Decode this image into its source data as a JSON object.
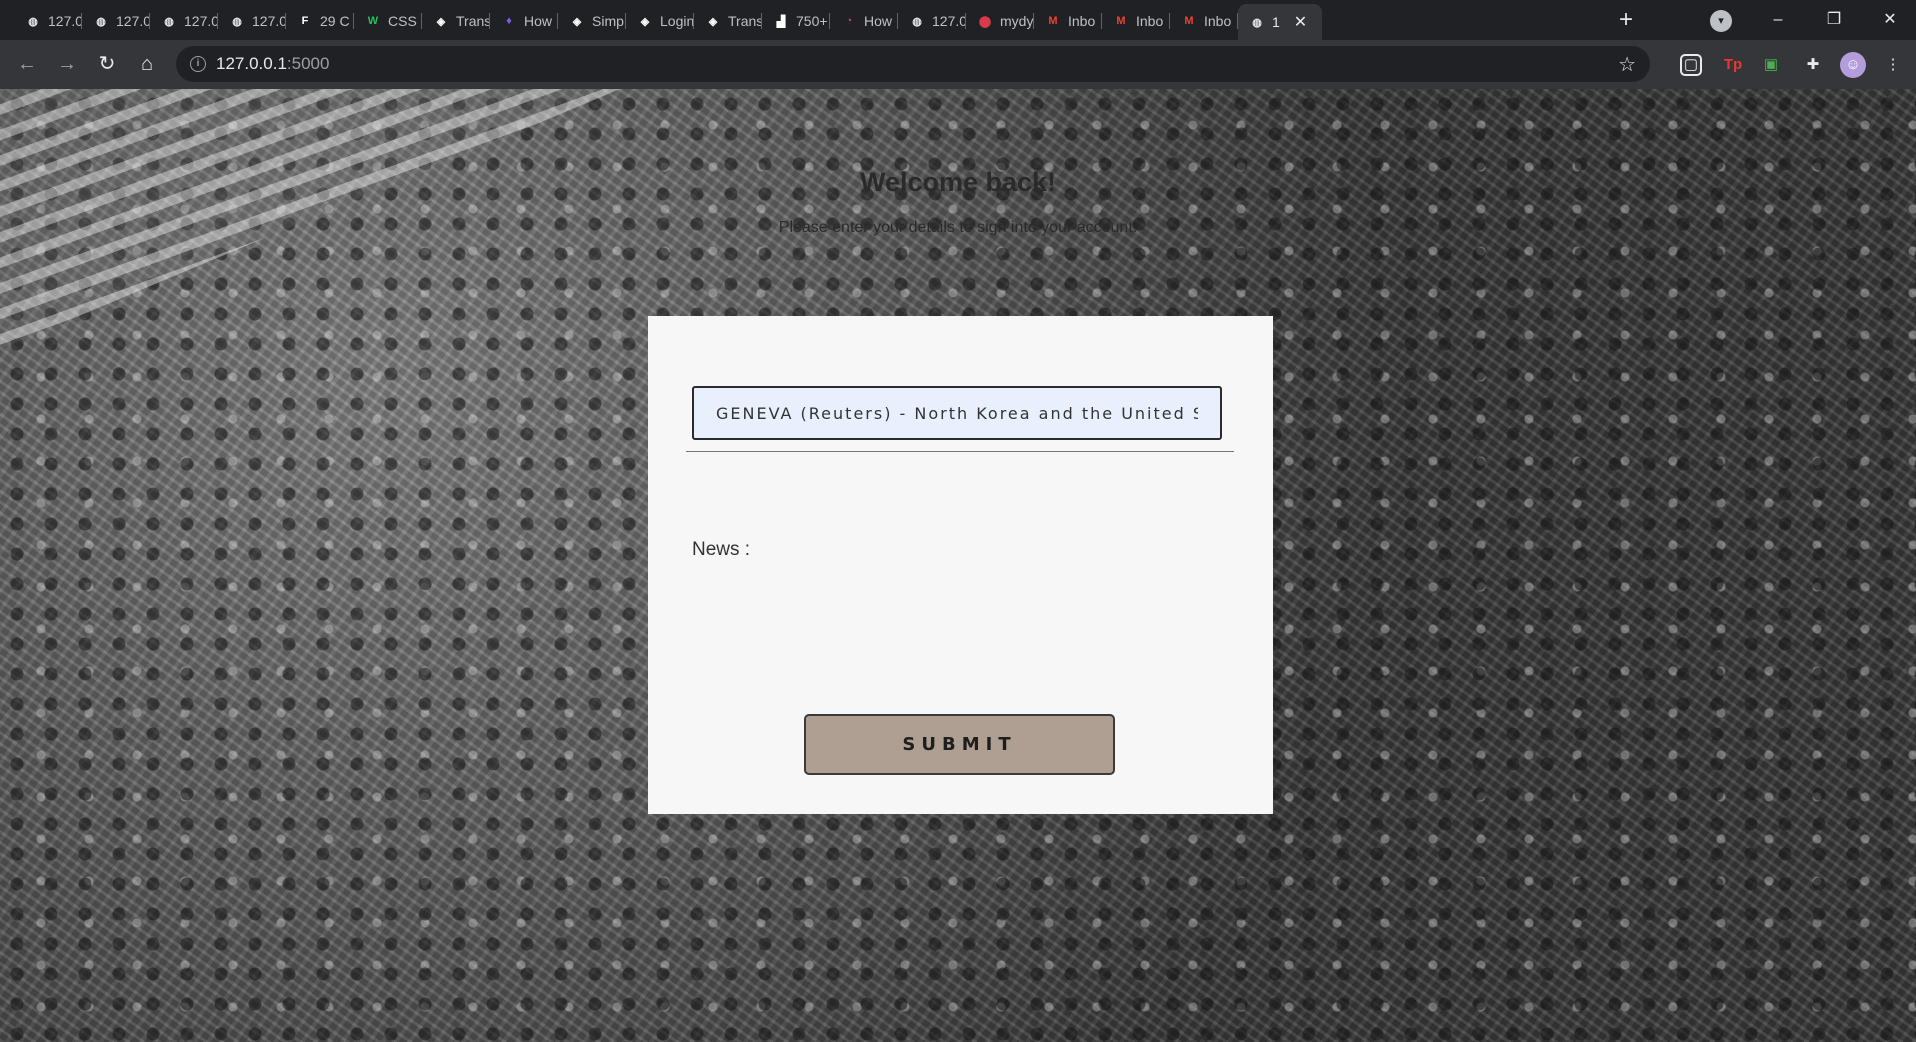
{
  "browser": {
    "tabs": [
      {
        "title": "127.0",
        "icon": "globe-icon",
        "color": "#e8eaed"
      },
      {
        "title": "127.0",
        "icon": "globe-icon",
        "color": "#e8eaed"
      },
      {
        "title": "127.0",
        "icon": "globe-icon",
        "color": "#e8eaed"
      },
      {
        "title": "127.0",
        "icon": "globe-icon",
        "color": "#e8eaed"
      },
      {
        "title": "29 C",
        "icon": "f-icon",
        "color": "#ffffff"
      },
      {
        "title": "CSS F",
        "icon": "w-icon",
        "color": "#2bc25a"
      },
      {
        "title": "Trans",
        "icon": "codepen-icon",
        "color": "#ffffff"
      },
      {
        "title": "How",
        "icon": "figma-icon",
        "color": "#7b5cf5"
      },
      {
        "title": "Simp",
        "icon": "codepen-icon",
        "color": "#ffffff"
      },
      {
        "title": "Login",
        "icon": "codepen-icon",
        "color": "#ffffff"
      },
      {
        "title": "Trans",
        "icon": "codepen-icon",
        "color": "#ffffff"
      },
      {
        "title": "750+",
        "icon": "blocks-icon",
        "color": "#ffffff"
      },
      {
        "title": "How",
        "icon": "swirl-icon",
        "color": "#e94235"
      },
      {
        "title": "127.0",
        "icon": "globe-icon",
        "color": "#e8eaed"
      },
      {
        "title": "mydy",
        "icon": "pin-icon",
        "color": "#d93a4a"
      },
      {
        "title": "Inbo",
        "icon": "gmail-icon",
        "color": "#ea4335"
      },
      {
        "title": "Inbo",
        "icon": "gmail-icon",
        "color": "#ea4335"
      },
      {
        "title": "Inbo",
        "icon": "gmail-icon",
        "color": "#ea4335"
      },
      {
        "title": "1",
        "icon": "globe-icon",
        "color": "#e8eaed",
        "active": true
      }
    ],
    "new_tab_label": "+",
    "url_host": "127.0.0.1",
    "url_port": ":5000"
  },
  "page": {
    "heading": "Welcome back!",
    "subheading": "Please enter your details to sign into your account.",
    "news_input_value": "GENEVA (Reuters) - North Korea and the United States",
    "news_label": "News :",
    "submit_label": "SUBMIT"
  }
}
